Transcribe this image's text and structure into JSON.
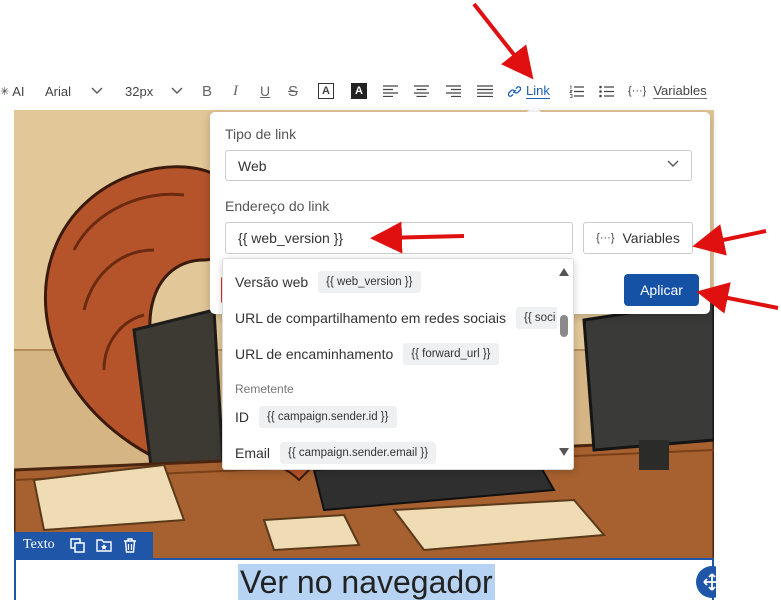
{
  "toolbar": {
    "ai_label": "AI",
    "font_family": "Arial",
    "font_size": "32px",
    "bold_label": "B",
    "italic_label": "I",
    "underline_label": "U",
    "strike_label": "S",
    "text_color_label": "A",
    "bg_color_label": "A",
    "link_label": "Link",
    "variables_label": "Variables"
  },
  "link_popover": {
    "link_type_label": "Tipo de link",
    "link_type_value": "Web",
    "address_label": "Endereço do link",
    "address_value": "{{ web_version }}",
    "variables_button": "Variables",
    "apply_button": "Aplicar"
  },
  "variables_dropdown": {
    "items": [
      {
        "label": "Versão web",
        "tag": "{{ web_version }}"
      },
      {
        "label": "URL de compartilhamento em redes sociais",
        "tag": "{{ soci"
      },
      {
        "label": "URL de encaminhamento",
        "tag": "{{ forward_url }}"
      }
    ],
    "group_label": "Remetente",
    "sender_items": [
      {
        "label": "ID",
        "tag": "{{ campaign.sender.id }}"
      },
      {
        "label": "Email",
        "tag": "{{ campaign.sender.email }}"
      }
    ]
  },
  "content_block": {
    "tag_label": "Texto",
    "heading_text": "Ver no navegador"
  },
  "colors": {
    "accent": "#1552a6",
    "block_blue": "#1f56a8",
    "link_blue": "#1a5fb4",
    "annotation_red": "#e01010",
    "selection": "#b6d3f3"
  },
  "icons": [
    "sparkle-icon",
    "chevron-down-icon",
    "link-icon",
    "ordered-list-icon",
    "bullet-list-icon",
    "variables-icon",
    "copy-icon",
    "save-block-icon",
    "trash-icon",
    "move-icon",
    "red-arrow-icon"
  ]
}
